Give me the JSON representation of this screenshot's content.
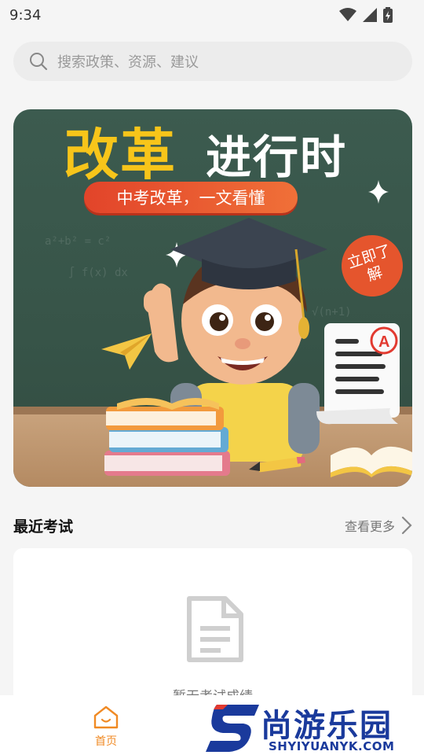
{
  "status_bar": {
    "time": "9:34"
  },
  "search": {
    "placeholder": "搜索政策、资源、建议"
  },
  "banner": {
    "title_part1": "改革",
    "title_part2": "进行时",
    "subtitle": "中考改革，一文看懂",
    "cta_label": "立即了解"
  },
  "recent_exams": {
    "title": "最近考试",
    "more_label": "查看更多",
    "empty_text": "暂无考试成绩"
  },
  "tabbar": {
    "items": [
      {
        "label": "首页",
        "icon": "home-icon",
        "active": true
      }
    ]
  },
  "watermark": {
    "name": "尚游乐园",
    "url": "SHYIYUANYK.COM"
  },
  "colors": {
    "accent": "#f08a24",
    "banner_yellow": "#f7c51a",
    "pill_red": "#e2442a",
    "watermark_blue": "#1a3a9c"
  }
}
